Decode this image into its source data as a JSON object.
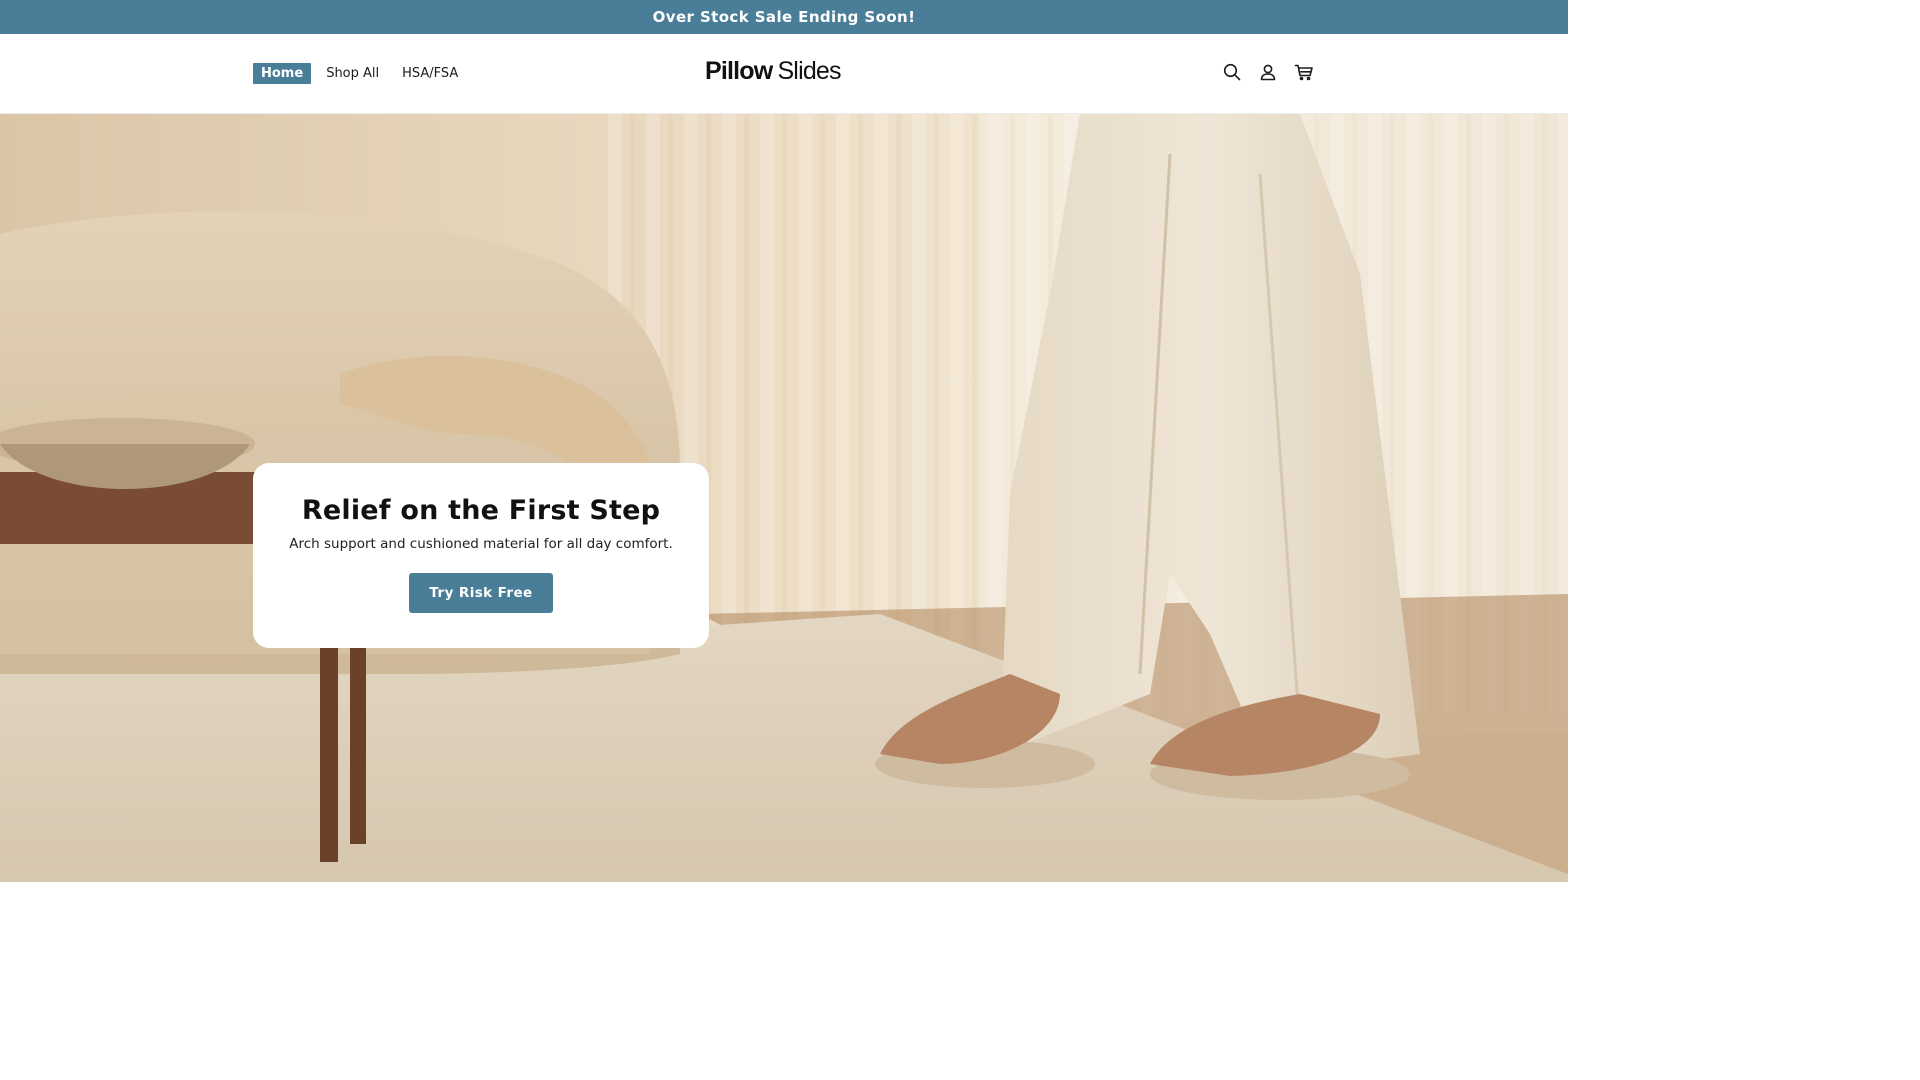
{
  "announcement": {
    "text": "Over Stock Sale Ending Soon!"
  },
  "header": {
    "nav": [
      {
        "label": "Home",
        "active": true
      },
      {
        "label": "Shop All",
        "active": false
      },
      {
        "label": "HSA/FSA",
        "active": false
      }
    ],
    "logo": {
      "bold": "Pillow",
      "light": "Slides"
    },
    "icons": [
      "search-icon",
      "account-icon",
      "cart-icon"
    ]
  },
  "hero": {
    "title": "Relief on the First Step",
    "subtitle": "Arch support and cushioned material for all day comfort.",
    "cta_label": "Try Risk Free"
  },
  "colors": {
    "accent": "#4a7d98",
    "background": "#ffffff",
    "text": "#111111"
  }
}
